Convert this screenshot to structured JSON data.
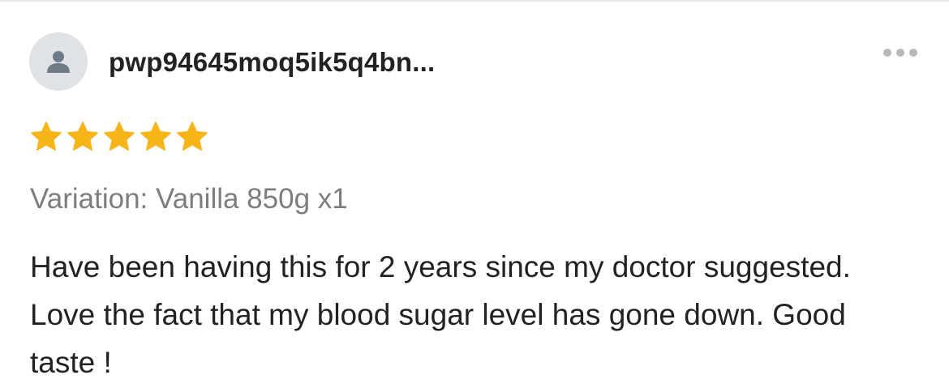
{
  "review": {
    "username": "pwp94645moq5ik5q4bn...",
    "avatar_icon": "user-silhouette-icon",
    "more_icon": "more-horizontal-icon",
    "rating": 5,
    "rating_max": 5,
    "star_color": "#f8b51a",
    "variation": "Variation: Vanilla 850g x1",
    "text": "Have been having this for 2 years since my doctor suggested. Love the fact that my blood sugar level has gone down. Good taste !"
  }
}
